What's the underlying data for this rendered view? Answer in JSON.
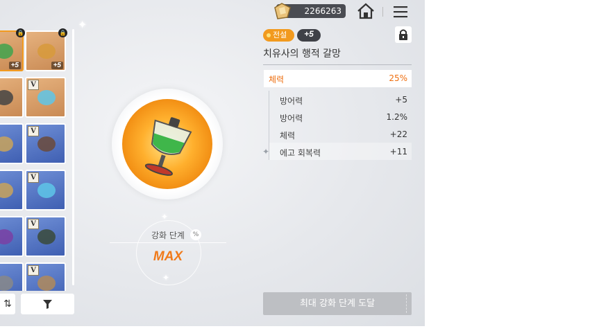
{
  "header": {
    "currency_amount": "2266263"
  },
  "inventory": {
    "slots": [
      {
        "col": 0,
        "row": 0,
        "frame": "orange",
        "upgrade": "+5",
        "locked": true,
        "selected": true,
        "tier": ""
      },
      {
        "col": 1,
        "row": 0,
        "frame": "orange",
        "upgrade": "+5",
        "locked": true,
        "selected": false,
        "tier": ""
      },
      {
        "col": 0,
        "row": 1,
        "frame": "orange",
        "upgrade": "",
        "locked": false,
        "selected": false,
        "tier": ""
      },
      {
        "col": 1,
        "row": 1,
        "frame": "orange",
        "upgrade": "",
        "locked": false,
        "selected": false,
        "tier": "V"
      },
      {
        "col": 0,
        "row": 2,
        "frame": "blue",
        "upgrade": "",
        "locked": false,
        "selected": false,
        "tier": ""
      },
      {
        "col": 1,
        "row": 2,
        "frame": "blue",
        "upgrade": "",
        "locked": false,
        "selected": false,
        "tier": "V"
      },
      {
        "col": 0,
        "row": 3,
        "frame": "blue",
        "upgrade": "",
        "locked": false,
        "selected": false,
        "tier": ""
      },
      {
        "col": 1,
        "row": 3,
        "frame": "blue",
        "upgrade": "",
        "locked": false,
        "selected": false,
        "tier": "V"
      },
      {
        "col": 0,
        "row": 4,
        "frame": "blue",
        "upgrade": "",
        "locked": false,
        "selected": false,
        "tier": ""
      },
      {
        "col": 1,
        "row": 4,
        "frame": "blue",
        "upgrade": "",
        "locked": false,
        "selected": false,
        "tier": "V"
      },
      {
        "col": 0,
        "row": 5,
        "frame": "blue",
        "upgrade": "",
        "locked": false,
        "selected": false,
        "tier": ""
      },
      {
        "col": 1,
        "row": 5,
        "frame": "blue",
        "upgrade": "",
        "locked": false,
        "selected": false,
        "tier": "V"
      }
    ]
  },
  "enhance": {
    "label": "강화 단계",
    "value": "MAX"
  },
  "detail": {
    "grade_label": "전설",
    "upgrade_level": "+5",
    "item_name": "치유사의 행적 갈망",
    "main_stat": {
      "name": "체력",
      "value": "25%"
    },
    "sub_stats": [
      {
        "name": "방어력",
        "value": "+5"
      },
      {
        "name": "방어력",
        "value": "1.2%"
      },
      {
        "name": "체력",
        "value": "+22"
      },
      {
        "name": "에고 회복력",
        "value": "+11"
      }
    ],
    "max_button_label": "최대 강화 단계 도달"
  },
  "colors": {
    "accent": "#f07a1a",
    "grade": "#f29a1e",
    "button_disabled": "#bdbfc3"
  },
  "icons": [
    "gem-icon",
    "home-icon",
    "menu-icon",
    "lock-icon",
    "sort-icon",
    "filter-icon",
    "potion-goblet-icon",
    "sparkle-icon"
  ]
}
